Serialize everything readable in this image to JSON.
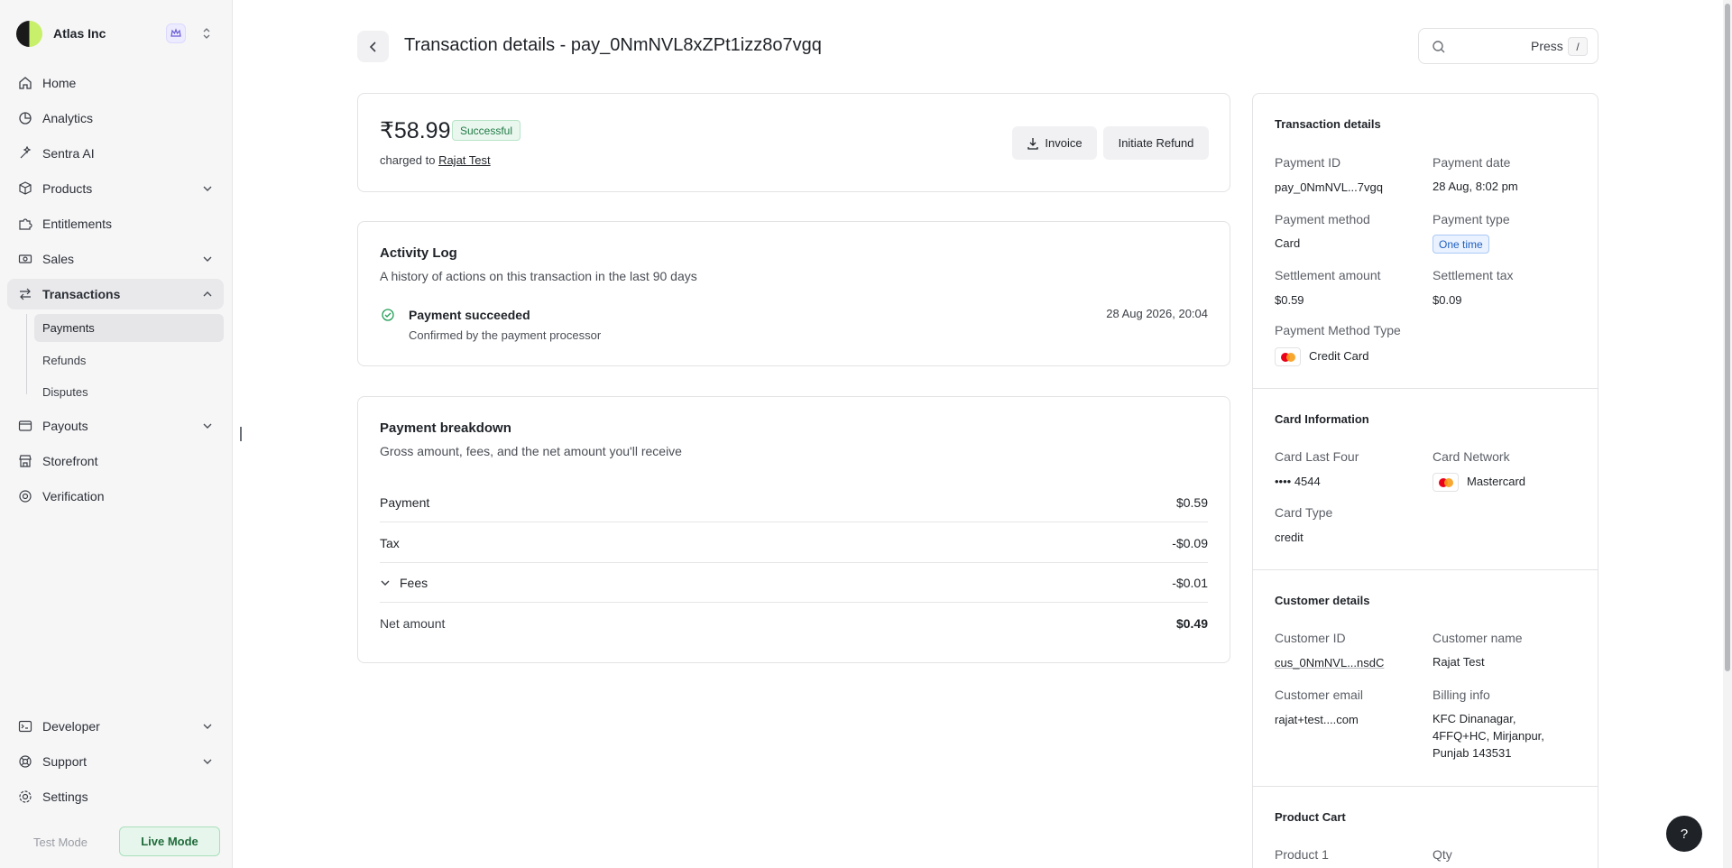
{
  "org": {
    "name": "Atlas Inc"
  },
  "sidebar": {
    "items": [
      {
        "label": "Home",
        "icon": "home-icon"
      },
      {
        "label": "Analytics",
        "icon": "analytics-icon"
      },
      {
        "label": "Sentra AI",
        "icon": "sparkle-icon"
      },
      {
        "label": "Products",
        "icon": "box-icon"
      },
      {
        "label": "Entitlements",
        "icon": "puzzle-icon"
      },
      {
        "label": "Sales",
        "icon": "cash-icon"
      },
      {
        "label": "Transactions",
        "icon": "transactions-icon"
      },
      {
        "label": "Payouts",
        "icon": "wallet-icon"
      },
      {
        "label": "Storefront",
        "icon": "storefront-icon"
      },
      {
        "label": "Verification",
        "icon": "verification-icon"
      },
      {
        "label": "Developer",
        "icon": "terminal-icon"
      },
      {
        "label": "Support",
        "icon": "support-icon"
      },
      {
        "label": "Settings",
        "icon": "gear-icon"
      }
    ],
    "sub_items": [
      "Payments",
      "Refunds",
      "Disputes"
    ],
    "mode": {
      "test": "Test Mode",
      "live": "Live Mode"
    }
  },
  "header": {
    "title": "Transaction details - pay_0NmNVL8xZPt1izz8o7vgq",
    "search_press": "Press",
    "search_key": "/"
  },
  "summary": {
    "amount": "₹58.99",
    "status": "Successful",
    "charged_prefix": "charged to",
    "customer": "Rajat Test",
    "invoice_label": "Invoice",
    "refund_label": "Initiate Refund"
  },
  "activity": {
    "title": "Activity Log",
    "subtitle": "A history of actions on this transaction in the last 90 days",
    "entry": {
      "title": "Payment succeeded",
      "desc": "Confirmed by the payment processor",
      "time": "28 Aug 2026, 20:04"
    }
  },
  "breakdown": {
    "title": "Payment breakdown",
    "subtitle": "Gross amount, fees, and the net amount you'll receive",
    "rows": [
      {
        "label": "Payment",
        "value": "$0.59"
      },
      {
        "label": "Tax",
        "value": "-$0.09"
      },
      {
        "label": "Fees",
        "value": "-$0.01"
      },
      {
        "label": "Net amount",
        "value": "$0.49"
      }
    ]
  },
  "details": {
    "title": "Transaction details",
    "payment_id_label": "Payment ID",
    "payment_id": "pay_0NmNVL...7vgq",
    "payment_date_label": "Payment date",
    "payment_date": "28 Aug, 8:02 pm",
    "method_label": "Payment method",
    "method": "Card",
    "type_label": "Payment type",
    "type": "One time",
    "settle_amount_label": "Settlement amount",
    "settle_amount": "$0.59",
    "settle_tax_label": "Settlement tax",
    "settle_tax": "$0.09",
    "method_type_label": "Payment Method Type",
    "method_type": "Credit Card"
  },
  "card_info": {
    "title": "Card Information",
    "last_four_label": "Card Last Four",
    "last_four": "•••• 4544",
    "network_label": "Card Network",
    "network": "Mastercard",
    "type_label": "Card Type",
    "type": "credit"
  },
  "customer": {
    "title": "Customer details",
    "id_label": "Customer ID",
    "id": "cus_0NmNVL...nsdC",
    "name_label": "Customer name",
    "name": "Rajat Test",
    "email_label": "Customer email",
    "email": "rajat+test....com",
    "billing_label": "Billing info",
    "billing_line1": "KFC Dinanagar,",
    "billing_line2": "4FFQ+HC, Mirjanpur,",
    "billing_line3": "Punjab 143531"
  },
  "cart": {
    "title": "Product Cart",
    "product_label": "Product 1",
    "qty_label": "Qty"
  },
  "help": {
    "label": "?"
  },
  "colors": {
    "success": "#1f7a43",
    "live_mode": "#1f6b3a",
    "pill_blue": "#1f5fbf"
  }
}
